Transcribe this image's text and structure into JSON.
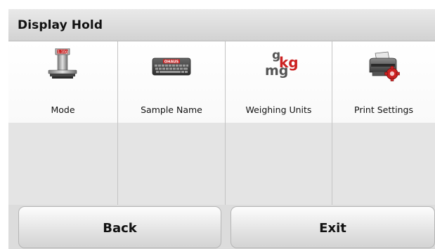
{
  "header": {
    "title": "Display Hold"
  },
  "menu": {
    "items": [
      {
        "label": "Mode",
        "icon": "balance-scale-icon"
      },
      {
        "label": "Sample Name",
        "icon": "keyboard-icon",
        "icon_text": "OHAUS"
      },
      {
        "label": "Weighing Units",
        "icon": "weighing-units-icon",
        "icon_text": {
          "g": "g",
          "kg": "kg",
          "mg": "mg"
        }
      },
      {
        "label": "Print Settings",
        "icon": "printer-settings-icon"
      }
    ],
    "scale_display": "1.10g"
  },
  "footer": {
    "back_label": "Back",
    "exit_label": "Exit"
  },
  "colors": {
    "accent_red": "#cc2222",
    "title_bar": "#dddddd",
    "grid_empty": "#e4e4e4"
  }
}
